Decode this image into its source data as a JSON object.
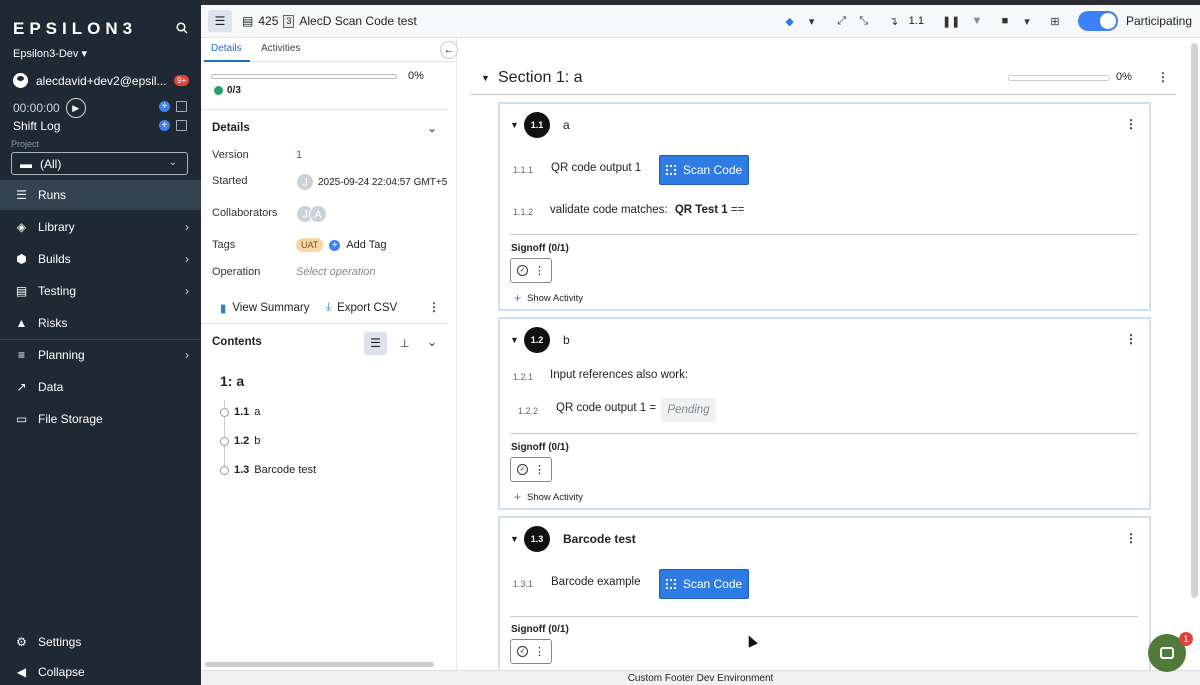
{
  "sidebar": {
    "brand": "EPSILON3",
    "org": "Epsilon3-Dev",
    "user": "alecdavid+dev2@epsil...",
    "notif_badge": "9+",
    "timer": "00:00:00",
    "shift_log": "Shift Log",
    "project_label": "Project",
    "project_value": "(All)",
    "nav": [
      {
        "label": "Runs",
        "icon": "checklist-icon",
        "active": true
      },
      {
        "label": "Library",
        "icon": "layers-icon"
      },
      {
        "label": "Builds",
        "icon": "boxes-icon"
      },
      {
        "label": "Testing",
        "icon": "clipboard-icon"
      },
      {
        "label": "Risks",
        "icon": "warning-icon"
      },
      {
        "label": "Planning",
        "icon": "bars-icon"
      },
      {
        "label": "Data",
        "icon": "line-chart-icon"
      },
      {
        "label": "File Storage",
        "icon": "folder-icon"
      }
    ],
    "settings": "Settings",
    "collapse": "Collapse"
  },
  "topbar": {
    "run_id": "425",
    "revision": "3",
    "title": "AlecD Scan Code test",
    "step_indicator": "1.1",
    "participating": "Participating"
  },
  "panel": {
    "tab_details": "Details",
    "tab_activities": "Activities",
    "progress_pct": "0%",
    "progress_count": "0/3",
    "details_heading": "Details",
    "version_label": "Version",
    "version_value": "1",
    "started_label": "Started",
    "started_avatar": "J",
    "started_value": "2025-09-24 22:04:57 GMT+5",
    "collab_label": "Collaborators",
    "collab_avatars": [
      "J",
      "A"
    ],
    "tags_label": "Tags",
    "tag": "UAT",
    "add_tag": "Add Tag",
    "operation_label": "Operation",
    "operation_placeholder": "Select operation",
    "view_summary": "View Summary",
    "export_csv": "Export CSV",
    "contents_heading": "Contents",
    "toc_section": "1: a",
    "toc_items": [
      {
        "num": "1.1",
        "label": "a"
      },
      {
        "num": "1.2",
        "label": "b"
      },
      {
        "num": "1.3",
        "label": "Barcode test"
      }
    ]
  },
  "main": {
    "section_title": "Section 1: a",
    "section_pct": "0%",
    "cards": [
      {
        "num": "1.1",
        "title": "a",
        "steps": [
          {
            "num": "1.1.1",
            "text": "QR code output 1",
            "button": "Scan Code"
          },
          {
            "num": "1.1.2",
            "text": "validate code matches:",
            "bold": "QR Test 1",
            "suffix": "=="
          }
        ],
        "signoff": "Signoff (0/1)",
        "activity": "Show Activity"
      },
      {
        "num": "1.2",
        "title": "b",
        "steps": [
          {
            "num": "1.2.1",
            "text": "Input references also work:"
          },
          {
            "num": "1.2.2",
            "text": "QR code output 1 =",
            "value": "Pending"
          }
        ],
        "signoff": "Signoff (0/1)",
        "activity": "Show Activity"
      },
      {
        "num": "1.3",
        "title": "Barcode test",
        "steps": [
          {
            "num": "1.3.1",
            "text": "Barcode example",
            "button": "Scan Code"
          }
        ],
        "signoff": "Signoff (0/1)"
      }
    ]
  },
  "footer": "Custom Footer Dev Environment",
  "chat_badge": "1",
  "colors": {
    "accent": "#2e7be3",
    "sidebar": "#1e2933",
    "success": "#22a06b",
    "danger": "#e0433a"
  }
}
